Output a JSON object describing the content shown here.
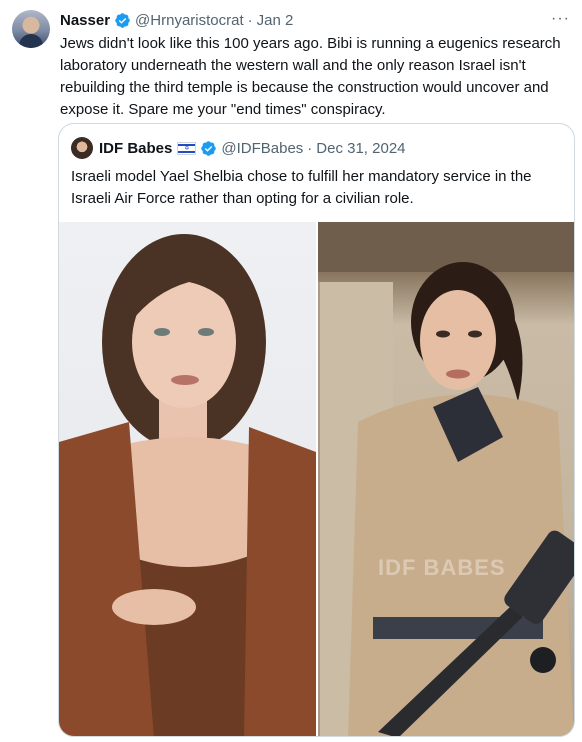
{
  "tweet": {
    "author_name": "Nasser",
    "handle": "@Hrnyaristocrat",
    "separator": "·",
    "date": "Jan 2",
    "more_label": "···",
    "text": "Jews didn't look like this 100 years ago. Bibi is running a eugenics research laboratory underneath the western wall and the only reason Israel isn't rebuilding the third temple is because the construction would uncover and expose it. Spare me your \"end times\" conspiracy."
  },
  "quoted_tweet": {
    "author_name": "IDF Babes",
    "flag_icon": "israel-flag-icon",
    "handle": "@IDFBabes",
    "separator": "·",
    "date": "Dec 31, 2024",
    "text": "Israeli model Yael Shelbia chose to fulfill her mandatory service in the Israeli Air Force rather than opting for a civilian role.",
    "watermark": "IDF BABES"
  },
  "colors": {
    "verified": "#1d9bf0",
    "text_primary": "#0f1419",
    "text_secondary": "#536471",
    "border": "#cfd9de"
  }
}
